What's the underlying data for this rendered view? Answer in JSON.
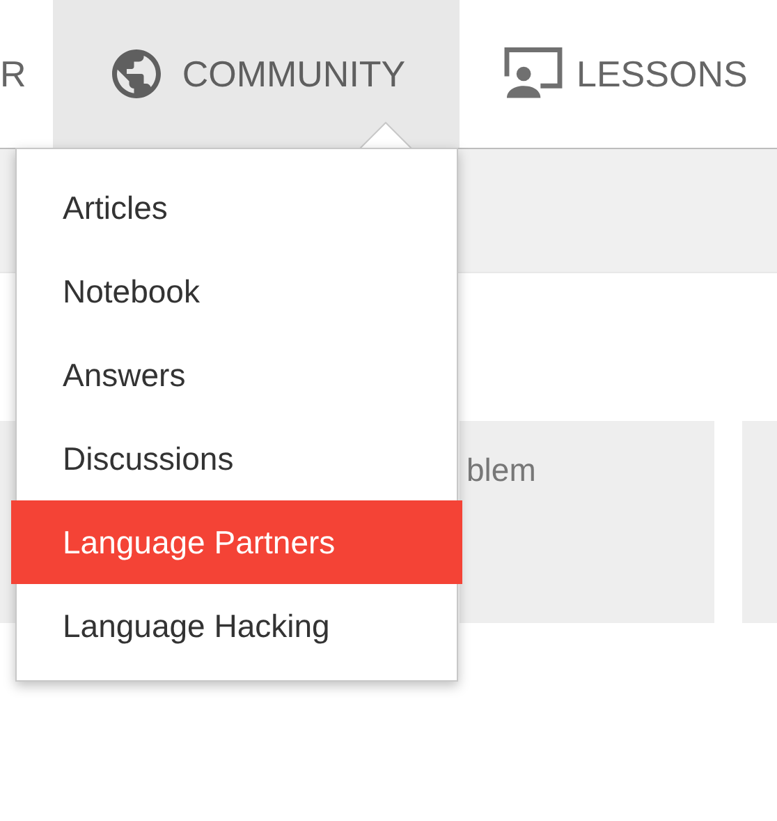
{
  "nav": {
    "tabs": [
      {
        "label": "R",
        "kind": "plain",
        "selected": false
      },
      {
        "label": "COMMUNITY",
        "kind": "globe",
        "selected": true
      },
      {
        "label": "LESSONS",
        "kind": "screen",
        "selected": false
      }
    ]
  },
  "menu": {
    "items": [
      {
        "label": "Articles",
        "selected": false
      },
      {
        "label": "Notebook",
        "selected": false
      },
      {
        "label": "Answers",
        "selected": false
      },
      {
        "label": "Discussions",
        "selected": false
      },
      {
        "label": "Language Partners",
        "selected": true
      },
      {
        "label": "Language Hacking",
        "selected": false
      }
    ]
  },
  "cards": [
    {
      "kind": "blank"
    },
    {
      "kind": "titled",
      "text": "blem"
    },
    {
      "kind": "blank"
    }
  ]
}
